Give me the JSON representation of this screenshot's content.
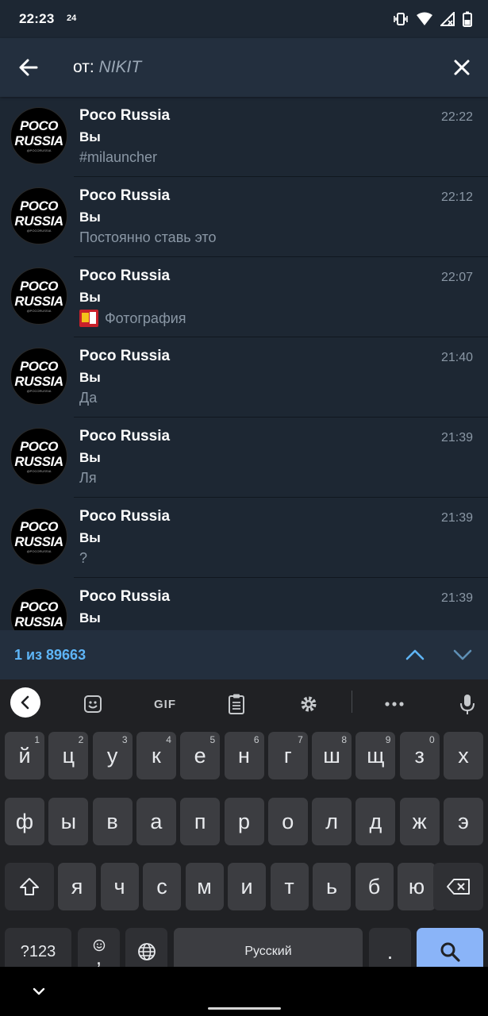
{
  "status_bar": {
    "time": "22:23",
    "badge": "24"
  },
  "search": {
    "prefix": "от:",
    "query": "NIKIT"
  },
  "results": [
    {
      "chat": "Poco Russia",
      "sender": "Вы",
      "preview": "#milauncher",
      "time": "22:22",
      "has_photo": false
    },
    {
      "chat": "Poco Russia",
      "sender": "Вы",
      "preview": "Постоянно ставь это",
      "time": "22:12",
      "has_photo": false
    },
    {
      "chat": "Poco Russia",
      "sender": "Вы",
      "preview": "Фотография",
      "time": "22:07",
      "has_photo": true
    },
    {
      "chat": "Poco Russia",
      "sender": "Вы",
      "preview": "Да",
      "time": "21:40",
      "has_photo": false
    },
    {
      "chat": "Poco Russia",
      "sender": "Вы",
      "preview": "Ля",
      "time": "21:39",
      "has_photo": false
    },
    {
      "chat": "Poco Russia",
      "sender": "Вы",
      "preview": "?",
      "time": "21:39",
      "has_photo": false
    },
    {
      "chat": "Poco Russia",
      "sender": "Вы",
      "preview": "",
      "time": "21:39",
      "has_photo": false
    }
  ],
  "avatar": {
    "line1": "POCO",
    "line2": "RUSSIA",
    "line3": "@POCORUSSIA"
  },
  "result_nav": {
    "count_text": "1 из 89663"
  },
  "keyboard": {
    "toolbar": {
      "gif_label": "GIF"
    },
    "row1": [
      {
        "k": "й",
        "h": "1"
      },
      {
        "k": "ц",
        "h": "2"
      },
      {
        "k": "у",
        "h": "3"
      },
      {
        "k": "к",
        "h": "4"
      },
      {
        "k": "е",
        "h": "5"
      },
      {
        "k": "н",
        "h": "6"
      },
      {
        "k": "г",
        "h": "7"
      },
      {
        "k": "ш",
        "h": "8"
      },
      {
        "k": "щ",
        "h": "9"
      },
      {
        "k": "з",
        "h": "0"
      },
      {
        "k": "х",
        "h": ""
      }
    ],
    "row2": [
      "ф",
      "ы",
      "в",
      "а",
      "п",
      "р",
      "о",
      "л",
      "д",
      "ж",
      "э"
    ],
    "row3": [
      "я",
      "ч",
      "с",
      "м",
      "и",
      "т",
      "ь",
      "б",
      "ю"
    ],
    "symbols_label": "?123",
    "comma_label": ",",
    "space_label": "Русский",
    "period_label": "."
  },
  "colors": {
    "background": "#1d2733",
    "header": "#232f3e",
    "accent": "#5eb5f7",
    "action_key": "#8ab4f8"
  }
}
